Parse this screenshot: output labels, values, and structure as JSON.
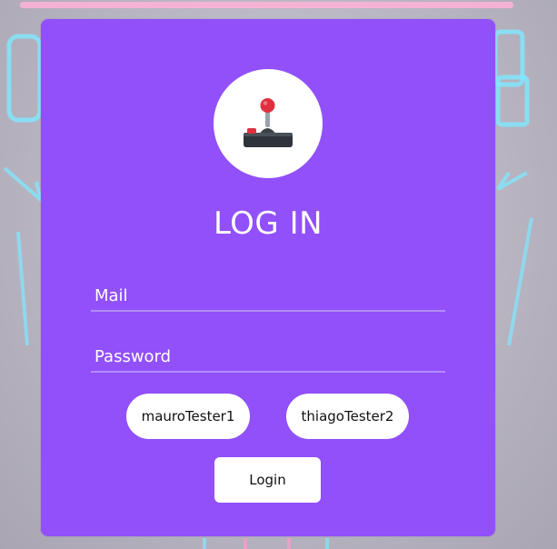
{
  "theme": {
    "card_color": "#9150fa",
    "neon_cyan": "#7fe8ff",
    "neon_pink": "#ff9ad0"
  },
  "login": {
    "logo_icon": "joystick-icon",
    "title": "LOG IN",
    "mail_placeholder": "Mail",
    "password_placeholder": "Password",
    "mail_value": "",
    "password_value": ""
  },
  "quick_users": [
    {
      "label": "mauroTester1"
    },
    {
      "label": "thiagoTester2"
    }
  ],
  "actions": {
    "login_label": "Login"
  }
}
